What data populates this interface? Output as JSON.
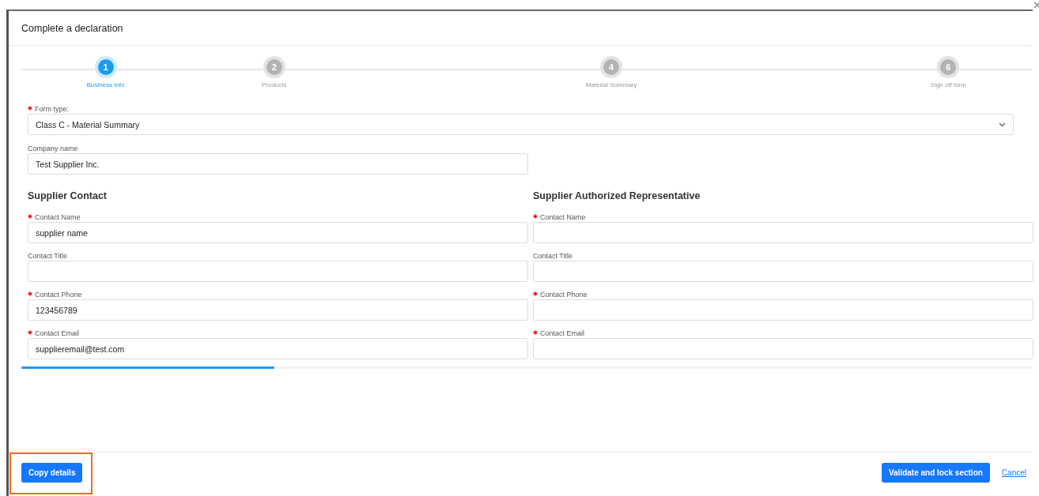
{
  "dialog": {
    "title": "Complete a declaration"
  },
  "steps": [
    {
      "number": "1",
      "label": "Business info",
      "selected": true
    },
    {
      "number": "2",
      "label": "Products",
      "selected": false
    },
    {
      "number": "4",
      "label": "Material Summary",
      "selected": false
    },
    {
      "number": "6",
      "label": "Sign off form",
      "selected": false
    }
  ],
  "form_type": {
    "label": "Form type:",
    "required": true,
    "value": "Class C - Material Summary"
  },
  "company_name": {
    "label": "Company name",
    "required": false,
    "value": "Test Supplier Inc."
  },
  "sections": [
    {
      "heading": "Supplier Contact",
      "fields": [
        {
          "label": "Contact Name",
          "required": true,
          "value": "supplier name"
        },
        {
          "label": "Contact Title",
          "required": false
        },
        {
          "label": "Contact Phone",
          "required": true,
          "value": "123456789"
        },
        {
          "label": "Contact Email",
          "required": true,
          "value": "supplieremail@test.com"
        }
      ]
    },
    {
      "heading": "Supplier Authorized Representative",
      "fields": [
        {
          "label": "Contact Name",
          "required": true
        },
        {
          "label": "Contact Title",
          "required": false
        },
        {
          "label": "Contact Phone",
          "required": true
        },
        {
          "label": "Contact Email",
          "required": true
        }
      ]
    }
  ],
  "progress": {
    "level": 0.25
  },
  "footer": {
    "copy_button": {
      "label": "Copy details",
      "highlighted": true
    },
    "validate_button": "Validate and lock section",
    "cancel_link": "Cancel"
  }
}
